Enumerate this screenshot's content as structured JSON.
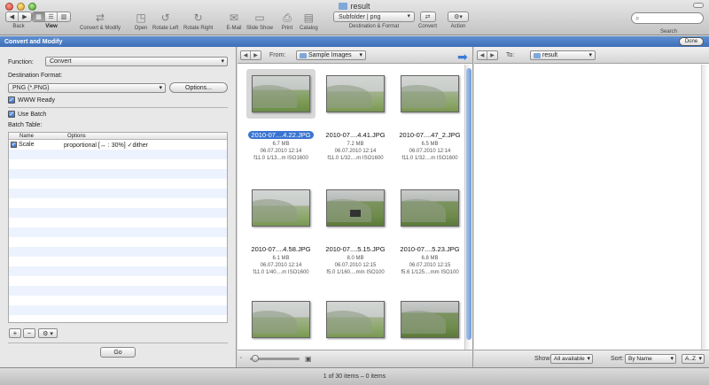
{
  "window": {
    "title": "result"
  },
  "toolbar": {
    "back_label": "Back",
    "view_label": "View",
    "convert_modify_label": "Convert & Modify",
    "open_label": "Open",
    "rotate_left_label": "Rotate Left",
    "rotate_right_label": "Rotate Right",
    "email_label": "E-Mail",
    "slideshow_label": "Slide Show",
    "print_label": "Print",
    "catalog_label": "Catalog",
    "dest_format_value": "Subfolder | png",
    "dest_format_label": "Destination & Format",
    "convert_label": "Convert",
    "action_label": "Action",
    "search_label": "Search",
    "icons": {
      "back": "back-arrow-icon",
      "forward": "forward-arrow-icon",
      "view_grid": "grid-icon",
      "view_list": "list-icon",
      "view_columns": "columns-icon",
      "convert": "convert-modify-icon",
      "open": "open-icon",
      "rotate_left": "rotate-left-icon",
      "rotate_right": "rotate-right-icon",
      "email": "email-icon",
      "slideshow": "slideshow-icon",
      "print": "print-icon",
      "catalog": "catalog-icon",
      "convert_btn": "convert-icon",
      "action": "gear-icon",
      "search": "search-icon"
    }
  },
  "panel_header": {
    "title": "Convert and Modify",
    "done_label": "Done"
  },
  "left": {
    "function_label": "Function:",
    "function_value": "Convert",
    "dest_format_label": "Destination Format:",
    "dest_format_value": "PNG (*.PNG)",
    "options_label": "Options...",
    "www_ready_label": "WWW Ready",
    "www_ready_checked": true,
    "use_batch_label": "Use Batch",
    "use_batch_checked": true,
    "batch_table_label": "Batch Table:",
    "batch_headers": [
      "Name",
      "Options"
    ],
    "batch_rows": [
      {
        "name": "Scale",
        "options": "proportional [↔ : 30%]  ✓dither",
        "checked": true
      }
    ],
    "add_label": "+",
    "remove_label": "−",
    "gear_label": "⚙ ▾",
    "go_label": "Go"
  },
  "source": {
    "from_label": "From:",
    "folder": "Sample Images",
    "show_label": "Show:",
    "show_value": "All available",
    "sort_label": "Sort:",
    "sort_value": "By Name",
    "order_value": "A..Z",
    "thumbnails": [
      {
        "name": "2010-07....4.22.JPG",
        "size": "6.7 MB",
        "date": "06.07.2010 12:14",
        "exif": "f11.0 1/13...m ISO1600",
        "selected": true
      },
      {
        "name": "2010-07....4.41.JPG",
        "size": "7.2 MB",
        "date": "06.07.2010 12:14",
        "exif": "f11.0 1/32....m ISO1600",
        "selected": false
      },
      {
        "name": "2010-07....47_2.JPG",
        "size": "6.5 MB",
        "date": "06.07.2010 12:14",
        "exif": "f11.0 1/32....m ISO1600",
        "selected": false
      },
      {
        "name": "2010-07....4.58.JPG",
        "size": "6.1 MB",
        "date": "06.07.2010 12:14",
        "exif": "f11.0 1/40....m ISO1600",
        "selected": false
      },
      {
        "name": "2010-07....5.15.JPG",
        "size": "8.0 MB",
        "date": "06.07.2010 12:15",
        "exif": "f5.0 1/160....mm ISO100",
        "selected": false
      },
      {
        "name": "2010-07....5.23.JPG",
        "size": "6.8 MB",
        "date": "06.07.2010 12:15",
        "exif": "f5.6 1/125....mm ISO100",
        "selected": false
      },
      {
        "name": "",
        "size": "",
        "date": "",
        "exif": "",
        "selected": false
      },
      {
        "name": "",
        "size": "",
        "date": "",
        "exif": "",
        "selected": false
      },
      {
        "name": "",
        "size": "",
        "date": "",
        "exif": "",
        "selected": false
      }
    ]
  },
  "destination": {
    "to_label": "To:",
    "folder": "result"
  },
  "status": {
    "text": "1 of 30 items – 0 items"
  }
}
